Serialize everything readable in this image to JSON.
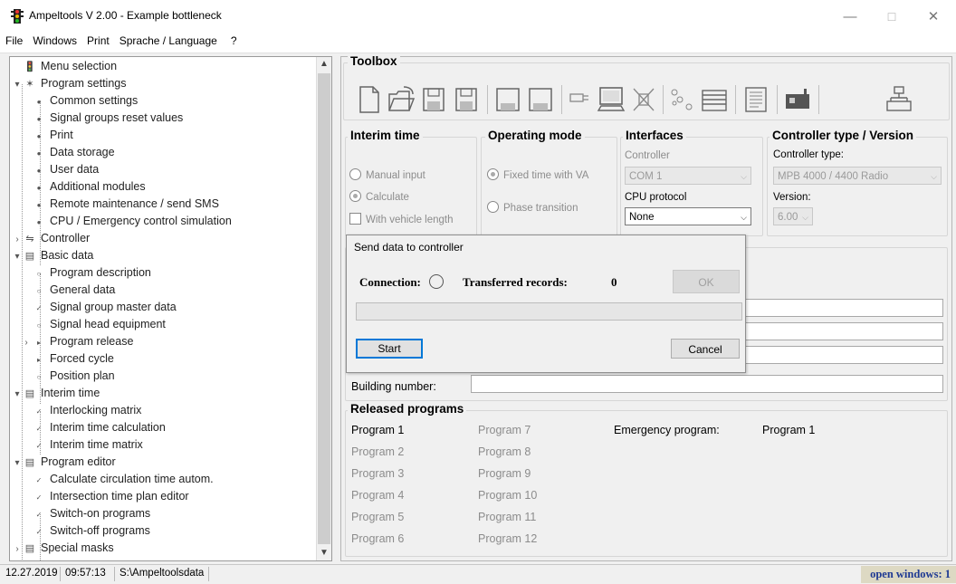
{
  "window": {
    "title": "Ampeltools V 2.00 - Example bottleneck"
  },
  "menu": [
    "File",
    "Windows",
    "Print",
    "Sprache / Language",
    "?"
  ],
  "tree": [
    {
      "label": "Menu selection",
      "level": 0
    },
    {
      "label": "Program settings",
      "level": 0
    },
    {
      "label": "Common settings",
      "level": 1
    },
    {
      "label": "Signal groups reset values",
      "level": 1
    },
    {
      "label": "Print",
      "level": 1
    },
    {
      "label": "Data storage",
      "level": 1
    },
    {
      "label": "User data",
      "level": 1
    },
    {
      "label": "Additional modules",
      "level": 1
    },
    {
      "label": "Remote maintenance / send SMS",
      "level": 1
    },
    {
      "label": "CPU / Emergency control simulation",
      "level": 1
    },
    {
      "label": "Controller",
      "level": 0
    },
    {
      "label": "Basic data",
      "level": 0
    },
    {
      "label": "Program description",
      "level": 1
    },
    {
      "label": "General data",
      "level": 1
    },
    {
      "label": "Signal group master data",
      "level": 1
    },
    {
      "label": "Signal head equipment",
      "level": 1
    },
    {
      "label": "Program release",
      "level": 1
    },
    {
      "label": "Forced cycle",
      "level": 1
    },
    {
      "label": "Position plan",
      "level": 1
    },
    {
      "label": "Interim time",
      "level": 0
    },
    {
      "label": "Interlocking matrix",
      "level": 1
    },
    {
      "label": "Interim time calculation",
      "level": 1
    },
    {
      "label": "Interim time matrix",
      "level": 1
    },
    {
      "label": "Program editor",
      "level": 0
    },
    {
      "label": "Calculate circulation time autom.",
      "level": 1
    },
    {
      "label": "Intersection time plan editor",
      "level": 1
    },
    {
      "label": "Switch-on programs",
      "level": 1
    },
    {
      "label": "Switch-off programs",
      "level": 1
    },
    {
      "label": "Special masks",
      "level": 0
    }
  ],
  "toolbox": {
    "title": "Toolbox"
  },
  "interim": {
    "title": "Interim time",
    "manual": "Manual input",
    "calculate": "Calculate",
    "vehicle": "With vehicle length"
  },
  "operating": {
    "title": "Operating mode",
    "fixed": "Fixed time with VA",
    "phase": "Phase transition"
  },
  "interfaces": {
    "title": "Interfaces",
    "controller_label": "Controller",
    "controller_value": "COM 1",
    "cpu_label": "CPU protocol",
    "cpu_value": "None"
  },
  "ctype": {
    "title": "Controller type / Version",
    "type_label": "Controller type:",
    "type_value": "MPB 4000 / 4400 Radio",
    "version_label": "Version:",
    "version_value": "6.00"
  },
  "general": {
    "building_label": "Building number:"
  },
  "released": {
    "title": "Released programs",
    "col1": [
      "Program 1",
      "Program 2",
      "Program 3",
      "Program 4",
      "Program 5",
      "Program 6"
    ],
    "col2": [
      "Program 7",
      "Program 8",
      "Program 9",
      "Program 10",
      "Program 11",
      "Program 12"
    ],
    "emergency_label": "Emergency program:",
    "emergency_value": "Program 1"
  },
  "dialog": {
    "title": "Send data to controller",
    "connection": "Connection:",
    "records_label": "Transferred records:",
    "records_value": "0",
    "ok": "OK",
    "start": "Start",
    "cancel": "Cancel",
    "progress": 0
  },
  "status": {
    "date": "12.27.2019",
    "time": "09:57:13",
    "path": "S:\\Ampeltoolsdata",
    "open_windows": "open windows: 1"
  }
}
